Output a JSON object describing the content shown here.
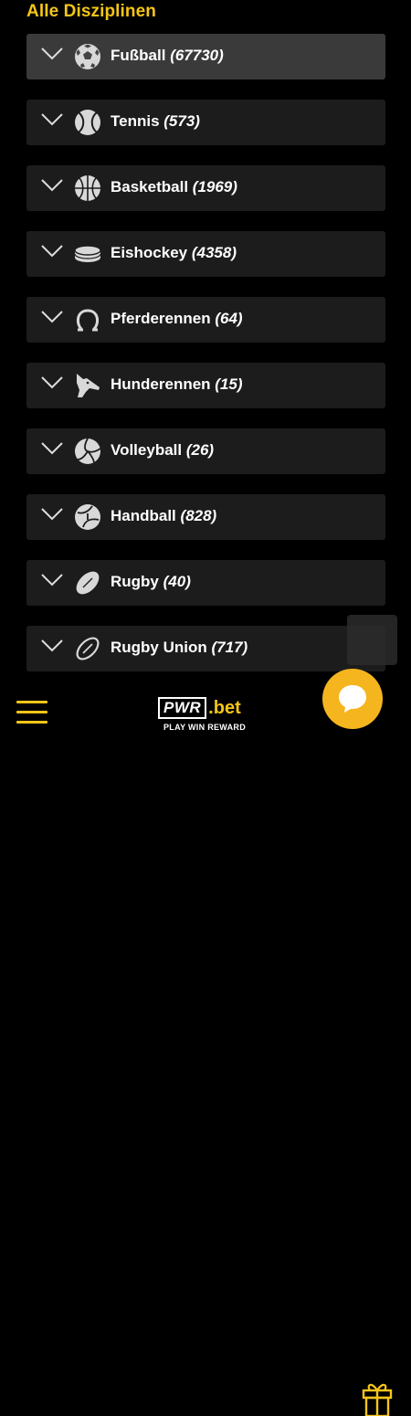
{
  "header": {
    "title": "Alle Disziplinen"
  },
  "sports": [
    {
      "name": "Fußball",
      "count": "(67730)",
      "icon": "football-icon",
      "active": true
    },
    {
      "name": "Tennis",
      "count": "(573)",
      "icon": "tennis-icon"
    },
    {
      "name": "Basketball",
      "count": "(1969)",
      "icon": "basketball-icon"
    },
    {
      "name": "Eishockey",
      "count": "(4358)",
      "icon": "ice-hockey-puck-icon"
    },
    {
      "name": "Pferderennen",
      "count": "(64)",
      "icon": "horseshoe-icon"
    },
    {
      "name": "Hunderennen",
      "count": "(15)",
      "icon": "greyhound-icon"
    },
    {
      "name": "Volleyball",
      "count": "(26)",
      "icon": "volleyball-icon"
    },
    {
      "name": "Handball",
      "count": "(828)",
      "icon": "handball-icon"
    },
    {
      "name": "Rugby",
      "count": "(40)",
      "icon": "rugby-ball-icon"
    },
    {
      "name": "Rugby Union",
      "count": "(717)",
      "icon": "rugby-union-ball-icon"
    }
  ],
  "footer": {
    "logo_pwr": "PWR",
    "logo_bet": ".bet",
    "logo_tagline": "PLAY WIN REWARD"
  },
  "colors": {
    "accent": "#f5c518",
    "row_bg": "#1c1c1c",
    "row_active_bg": "#3a3a3a",
    "chat_bg": "#f5b51f"
  }
}
